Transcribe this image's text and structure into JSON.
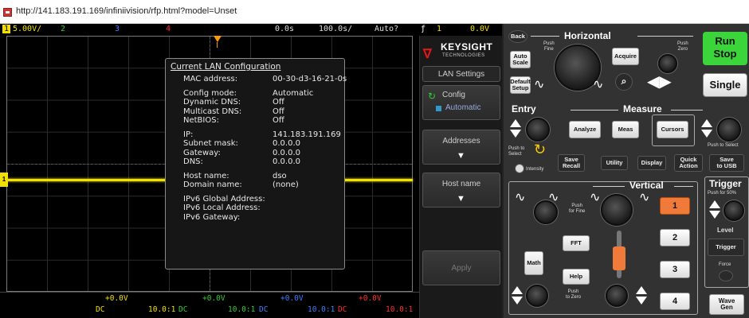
{
  "browser": {
    "url": "http://141.183.191.169/infiniivision/rfp.html?model=Unset"
  },
  "status_bar": {
    "ch1_num": "1",
    "ch1_scale": "5.00V/",
    "ch2_num": "2",
    "ch3_num": "3",
    "ch4_num": "4",
    "time_pos": "0.0s",
    "time_scale": "100.0s/",
    "mode": "Auto?",
    "trig_icon": "ƒ",
    "trig_ch": "1",
    "trig_level": "0.0V"
  },
  "lan_config": {
    "title": "Current LAN Configuration",
    "rows_a": [
      {
        "k": "MAC address:",
        "v": "00-30-d3-16-21-0s"
      }
    ],
    "rows_b": [
      {
        "k": "Config mode:",
        "v": "Automatic"
      },
      {
        "k": "Dynamic DNS:",
        "v": "Off"
      },
      {
        "k": "Multicast DNS:",
        "v": "Off"
      },
      {
        "k": "NetBIOS:",
        "v": "Off"
      }
    ],
    "rows_c": [
      {
        "k": "IP:",
        "v": "141.183.191.169"
      },
      {
        "k": "Subnet mask:",
        "v": "0.0.0.0"
      },
      {
        "k": "Gateway:",
        "v": "0.0.0.0"
      },
      {
        "k": "DNS:",
        "v": "0.0.0.0"
      }
    ],
    "rows_d": [
      {
        "k": "Host name:",
        "v": "dso"
      },
      {
        "k": "Domain name:",
        "v": "(none)"
      }
    ],
    "ipv6": [
      "IPv6 Global Address:",
      "IPv6 Local Address:",
      "IPv6 Gateway:"
    ]
  },
  "bottom_bar": {
    "ch1": {
      "offset": "+0.0V",
      "coupling": "DC",
      "probe": "10.0:1"
    },
    "ch2": {
      "offset": "+0.0V",
      "coupling": "DC",
      "probe": "10.0:1"
    },
    "ch3": {
      "offset": "+0.0V",
      "coupling": "DC",
      "probe": "10.0:1"
    },
    "ch4": {
      "offset": "+0.0V",
      "coupling": "DC",
      "probe": "10.0:1"
    }
  },
  "softkeys": {
    "brand": "KEYSIGHT",
    "brand_sub": "TECHNOLOGIES",
    "title": "LAN Settings",
    "config_label": "Config",
    "config_value": "Automatic",
    "addresses": "Addresses",
    "host_name": "Host name",
    "apply": "Apply"
  },
  "panel": {
    "back": "Back",
    "horizontal": "Horizontal",
    "push_fine": "Push\nFine",
    "push_zero": "Push\nZero",
    "auto_scale": "Auto\nScale",
    "acquire": "Acquire",
    "default_setup": "Default\nSetup",
    "run_stop_1": "Run",
    "run_stop_2": "Stop",
    "single": "Single",
    "entry": "Entry",
    "measure": "Measure",
    "analyze": "Analyze",
    "meas": "Meas",
    "cursors": "Cursors",
    "push_select": "Push to Select",
    "push_to_select": "Push to\nSelect",
    "intensity": "Intensity",
    "save_recall": "Save\nRecall",
    "utility": "Utility",
    "display": "Display",
    "quick_action": "Quick\nAction",
    "save_usb": "Save\nto USB",
    "vertical": "Vertical",
    "trigger": "Trigger",
    "push_50": "Push for 50%",
    "level": "Level",
    "trigger_btn": "Trigger",
    "force": "Force",
    "push_for_fine": "Push\nfor Fine",
    "fft": "FFT",
    "math": "Math",
    "help": "Help",
    "push_to_zero": "Push\nto Zero",
    "ch_buttons": [
      "1",
      "2",
      "3",
      "4"
    ],
    "wave_gen": "Wave\nGen"
  },
  "colors": {
    "ch1": "#f2e100",
    "ch2": "#33cc33",
    "ch3": "#3f7fff",
    "ch4": "#ff3030",
    "trigger_marker": "#ff9900",
    "run_stop": "#3bd43b",
    "ch1_active": "#f07a3a"
  },
  "icons": {
    "favicon": "oscilloscope-favicon-icon",
    "keysight_logo": "keysight-wave-icon",
    "config_cycle": "cycle-arrow-icon",
    "arrow_down": "down-arrow-icon",
    "knob": "rotary-knob-icon"
  }
}
